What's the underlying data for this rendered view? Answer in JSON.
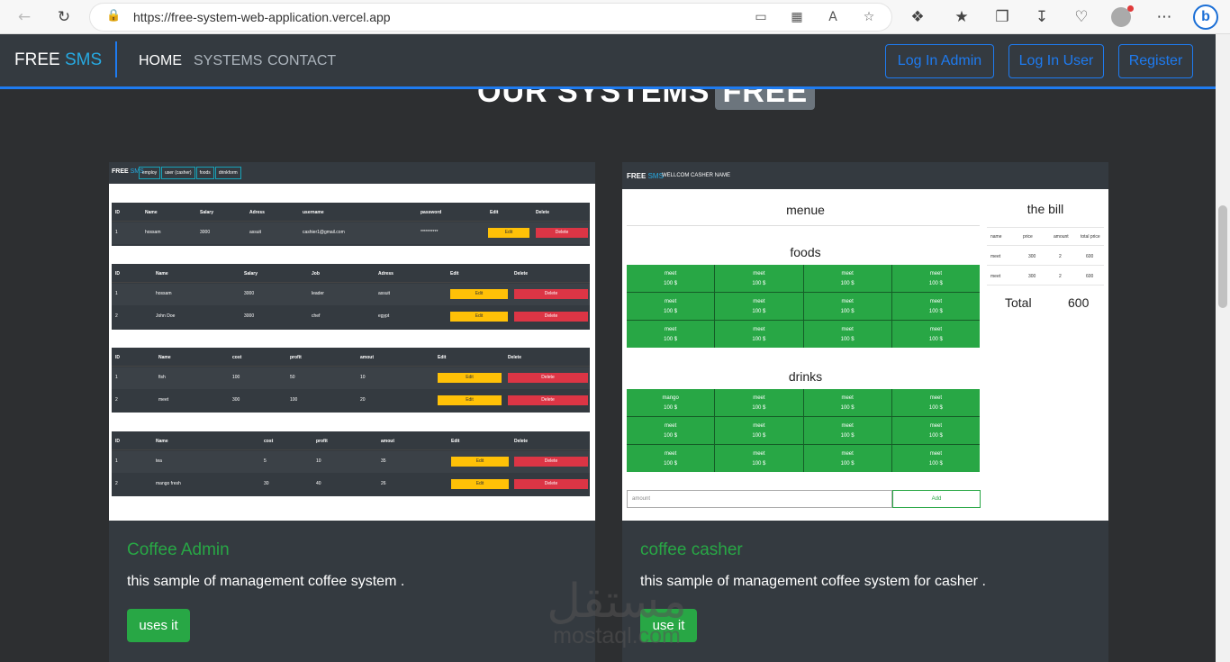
{
  "browser": {
    "url": "https://free-system-web-application.vercel.app"
  },
  "nav": {
    "brand_main": "FREE",
    "brand_accent": "SMS",
    "links": [
      "HOME",
      "SYSTEMS",
      "CONTACT"
    ],
    "buttons": [
      "Log In Admin",
      "Log In User",
      "Register"
    ]
  },
  "heading": {
    "text": "OUR SYSTEMS",
    "badge": "FREE"
  },
  "cards": [
    {
      "title": "Coffee Admin",
      "text": "this sample of management coffee system .",
      "button": "uses it",
      "preview": {
        "brand_main": "FREE",
        "brand_accent": "SMS",
        "tabs": [
          "employ",
          "user (casher)",
          "foods",
          "drinkform"
        ],
        "tables": [
          {
            "headers": [
              "ID",
              "Name",
              "Salary",
              "Adress",
              "username",
              "password",
              "Edit",
              "Delete"
            ],
            "rows": [
              [
                "1",
                "hossam",
                "3000",
                "assuit",
                "cashier1@gmail.com",
                "**********",
                "Edit",
                "Delete"
              ]
            ]
          },
          {
            "headers": [
              "ID",
              "Name",
              "Salary",
              "Job",
              "Adress",
              "Edit",
              "Delete"
            ],
            "rows": [
              [
                "1",
                "hossam",
                "3000",
                "leader",
                "assuit",
                "Edit",
                "Delete"
              ],
              [
                "2",
                "John Doe",
                "3000",
                "chef",
                "egypt",
                "Edit",
                "Delete"
              ]
            ]
          },
          {
            "headers": [
              "ID",
              "Name",
              "cost",
              "profit",
              "amout",
              "Edit",
              "Delete"
            ],
            "rows": [
              [
                "1",
                "fish",
                "100",
                "50",
                "10",
                "Edit",
                "Delete"
              ],
              [
                "2",
                "meet",
                "300",
                "100",
                "20",
                "Edit",
                "Delete"
              ]
            ]
          },
          {
            "headers": [
              "ID",
              "Name",
              "cost",
              "profit",
              "amout",
              "Edit",
              "Delete"
            ],
            "rows": [
              [
                "1",
                "tea",
                "5",
                "10",
                "35",
                "Edit",
                "Delete"
              ],
              [
                "2",
                "mango fresh",
                "30",
                "40",
                "26",
                "Edit",
                "Delete"
              ]
            ]
          }
        ]
      }
    },
    {
      "title": "coffee casher",
      "text": "this sample of management coffee system for casher .",
      "button": "use it",
      "preview": {
        "brand_main": "FREE",
        "brand_accent": "SMS",
        "welcome": "WELLCOM CASHER NAME",
        "menu_title": "menue",
        "foods_title": "foods",
        "drinks_title": "drinks",
        "foods": [
          "meet",
          "meet",
          "meet",
          "meet",
          "meet",
          "meet",
          "meet",
          "meet",
          "meet",
          "meet",
          "meet",
          "meet"
        ],
        "drinks": [
          "mango",
          "meet",
          "meet",
          "meet",
          "meet",
          "meet",
          "meet",
          "meet",
          "meet",
          "meet",
          "meet",
          "meet"
        ],
        "price": "100 $",
        "bill_title": "the bill",
        "bill_headers": [
          "name",
          "price",
          "amount",
          "total price"
        ],
        "bill_rows": [
          [
            "meet",
            "300",
            "2",
            "600"
          ],
          [
            "meet",
            "300",
            "2",
            "600"
          ]
        ],
        "total_label": "Total",
        "total_value": "600",
        "amount_placeholder": "amount",
        "add_label": "Add"
      }
    }
  ],
  "watermark": {
    "arabic": "مستقل",
    "latin": "mostaql.com"
  }
}
